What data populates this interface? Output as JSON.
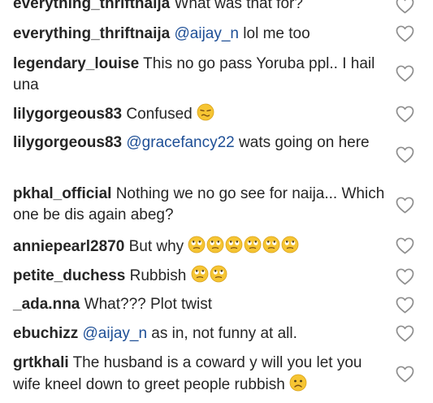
{
  "comments": [
    {
      "user": "everything_thriftnaija",
      "mention": "",
      "text": "What was that for?",
      "emoji": []
    },
    {
      "user": "everything_thriftnaija",
      "mention": "@aijay_n",
      "text": "lol me too",
      "emoji": []
    },
    {
      "user": "legendary_louise",
      "mention": "",
      "text": "This no go pass Yoruba ppl.. I hail una",
      "emoji": []
    },
    {
      "user": "lilygorgeous83",
      "mention": "",
      "text": "Confused",
      "emoji": [
        "confused-face-emoji"
      ]
    },
    {
      "user": "lilygorgeous83",
      "mention": "@gracefancy22",
      "text": "wats going on here",
      "emoji": []
    },
    {
      "user": "pkhal_official",
      "mention": "",
      "text": "Nothing we no go see for naija... Which one be dis again abeg?",
      "emoji": []
    },
    {
      "user": "anniepearl2870",
      "mention": "",
      "text": "But why",
      "emoji": [
        "eye-roll-face-emoji",
        "eye-roll-face-emoji",
        "eye-roll-face-emoji",
        "eye-roll-face-emoji",
        "eye-roll-face-emoji",
        "eye-roll-face-emoji"
      ]
    },
    {
      "user": "petite_duchess",
      "mention": "",
      "text": "Rubbish",
      "emoji": [
        "eye-roll-face-emoji",
        "eye-roll-face-emoji"
      ]
    },
    {
      "user": "_ada.nna",
      "mention": "",
      "text": "What??? Plot twist",
      "emoji": []
    },
    {
      "user": "ebuchizz",
      "mention": "@aijay_n",
      "text": "as in, not funny at all.",
      "emoji": []
    },
    {
      "user": "grtkhali",
      "mention": "",
      "text": "The husband is a coward y will you let you wife kneel down to greet people rubbish",
      "emoji": [
        "frown-face-emoji"
      ]
    }
  ],
  "colors": {
    "text": "#262626",
    "mention": "#1e4f96",
    "heart": "#8e8e8e",
    "emoji": "#f6c533"
  },
  "icons": {
    "like": "heart-outline-icon"
  }
}
